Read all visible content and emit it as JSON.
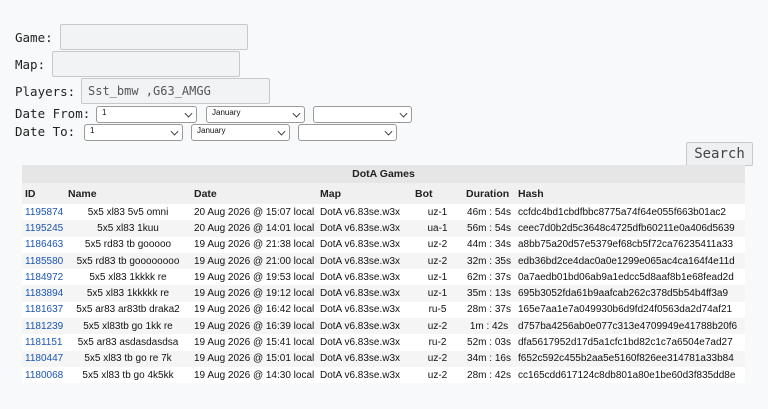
{
  "form": {
    "game_label": "Game:",
    "game_value": "",
    "map_label": "Map:",
    "map_value": "",
    "players_label": "Players:",
    "players_value": "Sst_bmw ,G63_AMGG",
    "date_from_label": "Date From:",
    "date_from": {
      "day": "1",
      "month": "January",
      "year": ""
    },
    "date_to_label": "Date To:",
    "date_to": {
      "day": "1",
      "month": "January",
      "year": ""
    },
    "search_label": "Search"
  },
  "table": {
    "title": "DotA Games",
    "columns": [
      "ID",
      "Name",
      "Date",
      "Map",
      "Bot",
      "Duration",
      "Hash"
    ],
    "rows": [
      [
        "1195874",
        "5x5 xl83 5v5 omni",
        "20 Aug 2026 @ 15:07 local",
        "DotA v6.83se.w3x",
        "uz-1",
        "46m : 54s",
        "ccfdc4bd1cbdfbbc8775a74f64e055f663b01ac2"
      ],
      [
        "1195245",
        "5x5 xl83 1kuu",
        "20 Aug 2026 @ 14:01 local",
        "DotA v6.83se.w3x",
        "ua-1",
        "56m : 54s",
        "ceec7d0b2d5c3648c4725dfb60211e0a406d5639"
      ],
      [
        "1186463",
        "5x5 rd83 tb gooooo",
        "19 Aug 2026 @ 21:38 local",
        "DotA v6.83se.w3x",
        "uz-2",
        "44m : 34s",
        "a8bb75a20d57e5379ef68cb5f72ca76235411a33"
      ],
      [
        "1185580",
        "5x5 rd83 tb goooooooo",
        "19 Aug 2026 @ 21:00 local",
        "DotA v6.83se.w3x",
        "uz-2",
        "32m : 35s",
        "edb36bd2ce4dac0a0e1299e065ac4ca164f4e11d"
      ],
      [
        "1184972",
        "5x5 xl83 1kkkk re",
        "19 Aug 2026 @ 19:53 local",
        "DotA v6.83se.w3x",
        "uz-1",
        "62m : 37s",
        "0a7aedb01bd06ab9a1edcc5d8aaf8b1e68fead2d"
      ],
      [
        "1183894",
        "5x5 xl83 1kkkkk re",
        "19 Aug 2026 @ 19:12 local",
        "DotA v6.83se.w3x",
        "uz-1",
        "35m : 13s",
        "695b3052fda61b9aafcab262c378d5b54b4ff3a9"
      ],
      [
        "1181637",
        "5x5 ar83 ar83tb draka2",
        "19 Aug 2026 @ 16:42 local",
        "DotA v6.83se.w3x",
        "ru-5",
        "28m : 37s",
        "165e7aa1e7a049930b6d9fd24f0563da2d74af21"
      ],
      [
        "1181239",
        "5x5 xl83tb go 1kk re",
        "19 Aug 2026 @ 16:39 local",
        "DotA v6.83se.w3x",
        "uz-2",
        "1m : 42s",
        "d757ba4256ab0e077c313e4709949e41788b20f6"
      ],
      [
        "1181151",
        "5x5 ar83 asdasdasdsa",
        "19 Aug 2026 @ 15:41 local",
        "DotA v6.83se.w3x",
        "ru-2",
        "52m : 03s",
        "dfa5617952d17d5a1cfc1bd82c1c7a6504e7ad27"
      ],
      [
        "1180447",
        "5x5 xl83 tb go re 7k",
        "19 Aug 2026 @ 15:01 local",
        "DotA v6.83se.w3x",
        "uz-2",
        "34m : 16s",
        "f652c592c455b2aa5e5160f826ee314781a33b84"
      ],
      [
        "1180068",
        "5x5 xl83 tb go 4k5kk",
        "19 Aug 2026 @ 14:30 local",
        "DotA v6.83se.w3x",
        "uz-2",
        "28m : 42s",
        "cc165cdd617124c8db801a80e1be60d3f835dd8e"
      ]
    ]
  },
  "colors": {
    "link": "#1a55b5",
    "page_bg": "#f8f9fa",
    "header_bg": "#e6e6e6"
  }
}
